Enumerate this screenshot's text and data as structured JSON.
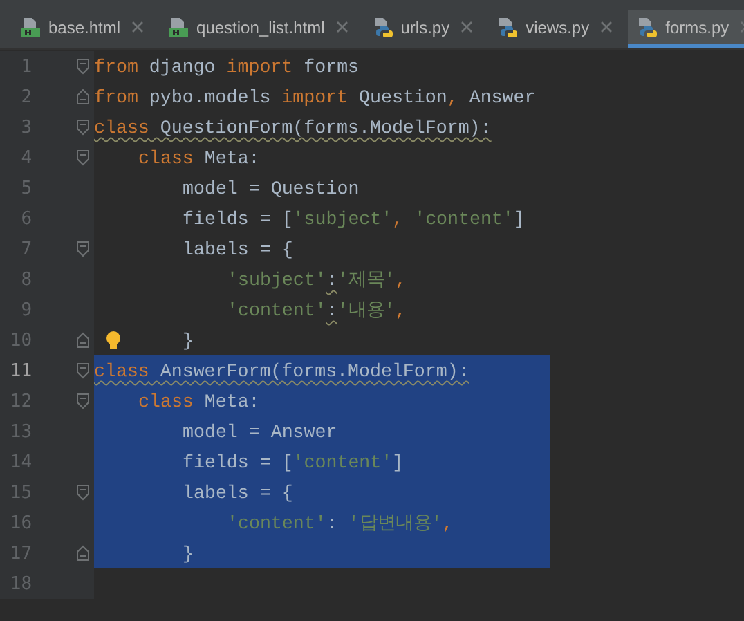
{
  "tabs": [
    {
      "label": "base.html",
      "kind": "html",
      "selected": false
    },
    {
      "label": "question_list.html",
      "kind": "html",
      "selected": false
    },
    {
      "label": "urls.py",
      "kind": "python",
      "selected": false
    },
    {
      "label": "views.py",
      "kind": "python",
      "selected": false
    },
    {
      "label": "forms.py",
      "kind": "python",
      "selected": true
    }
  ],
  "lines": [
    {
      "number": "1",
      "fold_start": true,
      "selected": false,
      "current": false,
      "tokens": [
        {
          "kind": "keyword",
          "text": "from"
        },
        {
          "kind": "plain",
          "text": " django "
        },
        {
          "kind": "keyword",
          "text": "import"
        },
        {
          "kind": "plain",
          "text": " forms"
        }
      ]
    },
    {
      "number": "2",
      "fold_end": true,
      "selected": false,
      "current": false,
      "tokens": [
        {
          "kind": "keyword",
          "text": "from"
        },
        {
          "kind": "plain",
          "text": " pybo.models "
        },
        {
          "kind": "keyword",
          "text": "import"
        },
        {
          "kind": "plain",
          "text": " Question"
        },
        {
          "kind": "punct",
          "text": ","
        },
        {
          "kind": "plain",
          "text": " Answer"
        }
      ]
    },
    {
      "number": "3",
      "fold_start": true,
      "selected": false,
      "current": false,
      "warning": true,
      "tokens": [
        {
          "kind": "keyword",
          "text": "class"
        },
        {
          "kind": "plain",
          "text": " QuestionForm(forms.ModelForm):"
        }
      ],
      "children": [
        {
          "number": "4",
          "fold_start": true,
          "selected": false,
          "current": false,
          "tokens": [
            {
              "kind": "keyword",
              "text": "class"
            },
            {
              "kind": "plain",
              "text": " Meta:"
            }
          ],
          "children": [
            {
              "number": "5",
              "selected": false,
              "current": false,
              "tokens": [
                {
                  "kind": "plain",
                  "text": "model = Question"
                }
              ]
            },
            {
              "number": "6",
              "selected": false,
              "current": false,
              "tokens": [
                {
                  "kind": "plain",
                  "text": "fields = ["
                },
                {
                  "kind": "string",
                  "text": "'subject'"
                },
                {
                  "kind": "punct",
                  "text": ", "
                },
                {
                  "kind": "string",
                  "text": "'content'"
                },
                {
                  "kind": "plain",
                  "text": "]"
                }
              ]
            },
            {
              "number": "7",
              "fold_start": true,
              "selected": false,
              "current": false,
              "tokens": [
                {
                  "kind": "plain",
                  "text": "labels = {"
                }
              ],
              "children": [
                {
                  "number": "8",
                  "selected": false,
                  "current": false,
                  "tokens": [
                    {
                      "kind": "string",
                      "text": "'subject'"
                    },
                    {
                      "kind": "plain",
                      "text": ":",
                      "warning": true
                    },
                    {
                      "kind": "string",
                      "text": "'제목'"
                    },
                    {
                      "kind": "punct",
                      "text": ","
                    }
                  ]
                },
                {
                  "number": "9",
                  "selected": false,
                  "current": false,
                  "tokens": [
                    {
                      "kind": "string",
                      "text": "'content'"
                    },
                    {
                      "kind": "plain",
                      "text": ":",
                      "warning": true
                    },
                    {
                      "kind": "string",
                      "text": "'내용'"
                    },
                    {
                      "kind": "punct",
                      "text": ","
                    }
                  ]
                }
              ]
            },
            {
              "number": "10",
              "fold_end": true,
              "bulb": true,
              "selected": false,
              "current": false,
              "tokens": [
                {
                  "kind": "plain",
                  "text": "}"
                }
              ]
            }
          ]
        }
      ]
    },
    {
      "number": "11",
      "fold_start": true,
      "selected": true,
      "current": true,
      "warning": true,
      "tokens": [
        {
          "kind": "keyword",
          "text": "class"
        },
        {
          "kind": "plain",
          "text": " AnswerForm(forms.ModelForm):"
        }
      ],
      "children": [
        {
          "number": "12",
          "fold_start": true,
          "selected": true,
          "current": false,
          "tokens": [
            {
              "kind": "keyword",
              "text": "class"
            },
            {
              "kind": "plain",
              "text": " Meta:"
            }
          ],
          "children": [
            {
              "number": "13",
              "selected": true,
              "current": false,
              "tokens": [
                {
                  "kind": "plain",
                  "text": "model = Answer"
                }
              ]
            },
            {
              "number": "14",
              "selected": true,
              "current": false,
              "tokens": [
                {
                  "kind": "plain",
                  "text": "fields = ["
                },
                {
                  "kind": "string",
                  "text": "'content'"
                },
                {
                  "kind": "plain",
                  "text": "]"
                }
              ]
            },
            {
              "number": "15",
              "fold_start": true,
              "selected": true,
              "current": false,
              "tokens": [
                {
                  "kind": "plain",
                  "text": "labels = {"
                }
              ],
              "children": [
                {
                  "number": "16",
                  "selected": true,
                  "current": false,
                  "tokens": [
                    {
                      "kind": "string",
                      "text": "'content'"
                    },
                    {
                      "kind": "plain",
                      "text": ": "
                    },
                    {
                      "kind": "string",
                      "text": "'답변내용'"
                    },
                    {
                      "kind": "punct",
                      "text": ","
                    }
                  ]
                }
              ]
            },
            {
              "number": "17",
              "fold_end": true,
              "selected": true,
              "current": false,
              "tokens": [
                {
                  "kind": "plain",
                  "text": "}"
                }
              ]
            }
          ]
        }
      ]
    },
    {
      "number": "18",
      "current": false
    }
  ]
}
